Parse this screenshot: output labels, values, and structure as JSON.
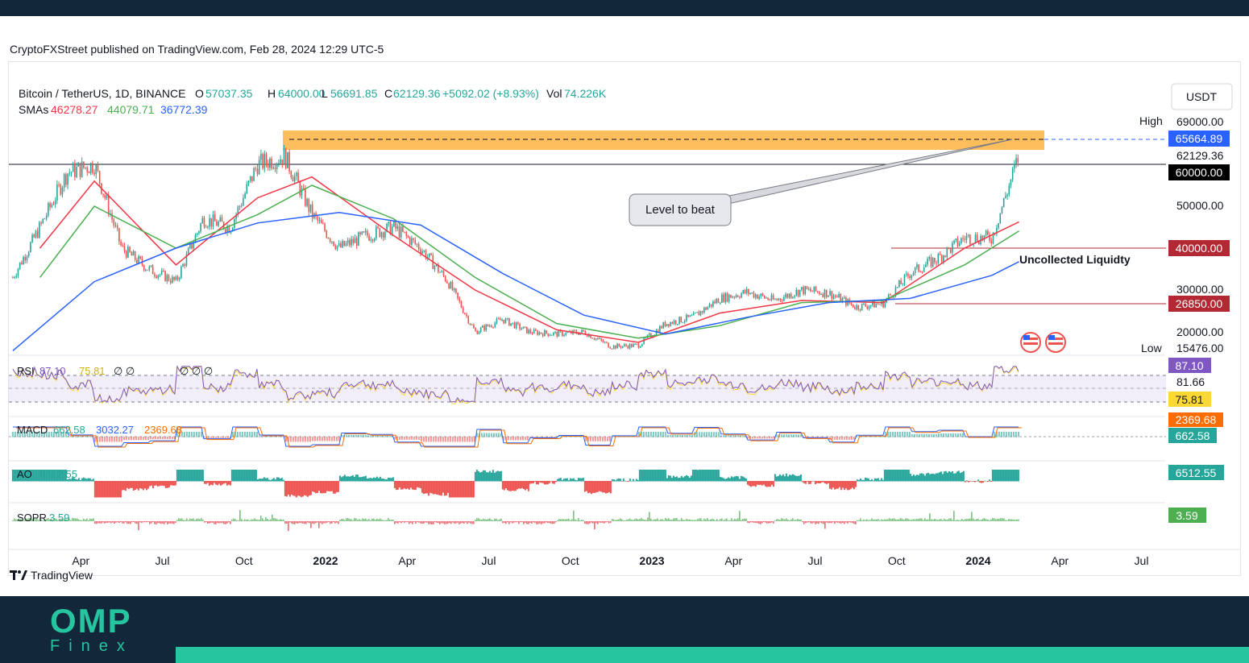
{
  "header": {
    "published": "CryptoFXStreet published on TradingView.com, Feb 28, 2024 12:29 UTC-5",
    "currency_button": "USDT"
  },
  "legend": {
    "symbol": "Bitcoin / TetherUS, 1D, BINANCE",
    "o_label": "O",
    "o": "57037.35",
    "h_label": "H",
    "h": "64000.00",
    "l_label": "L",
    "l": "56691.85",
    "c_label": "C",
    "c": "62129.36",
    "change": "+5092.02 (+8.93%)",
    "vol_label": "Vol",
    "vol": "74.226K",
    "sma_label": "SMAs",
    "sma_values": [
      "46278.27",
      "44079.71",
      "36772.39"
    ]
  },
  "colors": {
    "up": "#26a69a",
    "down": "#ef5350",
    "sma_fast": "#f23645",
    "sma_mid": "#4caf50",
    "sma_slow": "#2962ff",
    "zone": "#ffb74d",
    "rsi": "#7e57c2",
    "rsi_ma": "#fdd835",
    "macd": "#2962ff",
    "signal": "#ff6d00",
    "brand": "#27c4a0",
    "dark": "#12283a"
  },
  "price_scale": {
    "high_label": "High",
    "high": "69000.00",
    "low_label": "Low",
    "low": "15476.00",
    "labels": [
      "65664.89",
      "62129.36",
      "60000.00",
      "50000.00",
      "40000.00",
      "30000.00",
      "26850.00",
      "20000.00"
    ]
  },
  "annotations": {
    "level_to_beat": "Level to beat",
    "uncollected": "Uncollected Liquidty"
  },
  "indicators": {
    "rsi": {
      "label": "RSI",
      "v1": "87.10",
      "v2": "75.81",
      "nulls": "∅ ∅",
      "nulls2": "∅ ∅ ∅",
      "scale": [
        "87.10",
        "81.66",
        "75.81"
      ]
    },
    "macd": {
      "label": "MACD",
      "v1": "662.58",
      "v2": "3032.27",
      "v3": "2369.68",
      "scale": [
        "2369.68",
        "662.58"
      ]
    },
    "ao": {
      "label": "AO",
      "v1": "6512.55",
      "scale": [
        "6512.55"
      ]
    },
    "sopr": {
      "label": "SOPR",
      "v1": "3.59",
      "scale": [
        "3.59"
      ]
    }
  },
  "x_axis": [
    "Apr",
    "Jul",
    "Oct",
    "2022",
    "Apr",
    "Jul",
    "Oct",
    "2023",
    "Apr",
    "Jul",
    "Oct",
    "2024",
    "Apr",
    "Jul"
  ],
  "footer": {
    "tradingview": "TradingView",
    "brand_main": "OMP",
    "brand_sub": "Finex"
  },
  "chart_data": {
    "type": "line",
    "title": "Bitcoin / TetherUS, 1D, BINANCE",
    "series": [
      {
        "name": "Bitcoin / TetherUS",
        "x": [
          "2021-01",
          "2021-02",
          "2021-03",
          "2021-04",
          "2021-05",
          "2021-06",
          "2021-07",
          "2021-08",
          "2021-09",
          "2021-10",
          "2021-11",
          "2021-12",
          "2022-01",
          "2022-02",
          "2022-03",
          "2022-04",
          "2022-05",
          "2022-06",
          "2022-07",
          "2022-08",
          "2022-09",
          "2022-10",
          "2022-11",
          "2022-12",
          "2023-01",
          "2023-02",
          "2023-03",
          "2023-04",
          "2023-05",
          "2023-06",
          "2023-07",
          "2023-08",
          "2023-09",
          "2023-10",
          "2023-11",
          "2023-12",
          "2024-01",
          "2024-02"
        ],
        "values": [
          33000,
          45000,
          58000,
          60000,
          40000,
          35000,
          32000,
          47000,
          45000,
          60000,
          62000,
          48000,
          40000,
          43000,
          45000,
          40000,
          32000,
          20000,
          23000,
          20000,
          19500,
          20000,
          16500,
          16800,
          22000,
          23500,
          28000,
          29500,
          27500,
          30000,
          29300,
          26000,
          26800,
          34000,
          37500,
          42500,
          42500,
          62129
        ]
      },
      {
        "name": "SMA 46278.27",
        "x": [
          "2021-02",
          "2021-04",
          "2021-07",
          "2021-10",
          "2021-12",
          "2022-03",
          "2022-06",
          "2022-09",
          "2022-12",
          "2023-03",
          "2023-06",
          "2023-09",
          "2023-12",
          "2024-02"
        ],
        "values": [
          40000,
          56000,
          36000,
          52000,
          57000,
          43000,
          30000,
          20500,
          17500,
          24500,
          27500,
          27000,
          40000,
          46278
        ]
      },
      {
        "name": "SMA 44079.71",
        "x": [
          "2021-02",
          "2021-04",
          "2021-07",
          "2021-10",
          "2021-12",
          "2022-03",
          "2022-06",
          "2022-09",
          "2022-12",
          "2023-03",
          "2023-06",
          "2023-09",
          "2023-12",
          "2024-02"
        ],
        "values": [
          33000,
          50000,
          40000,
          48000,
          55000,
          47000,
          33000,
          22000,
          18500,
          21500,
          27000,
          27500,
          36000,
          44080
        ]
      },
      {
        "name": "SMA 36772.39",
        "x": [
          "2021-01",
          "2021-04",
          "2021-07",
          "2021-10",
          "2022-01",
          "2022-04",
          "2022-07",
          "2022-10",
          "2023-01",
          "2023-04",
          "2023-07",
          "2023-10",
          "2024-01",
          "2024-02"
        ],
        "values": [
          15500,
          32000,
          40000,
          46000,
          48500,
          45500,
          34000,
          24000,
          19500,
          23500,
          27000,
          28000,
          33500,
          36772
        ]
      }
    ],
    "horizontal_levels": [
      60000,
      40000,
      26850
    ],
    "resistance_zone": [
      63500,
      68500
    ],
    "resistance_level": 65664.89,
    "ylim": [
      15476,
      69000
    ],
    "rsi": {
      "value": 87.1,
      "ma": 75.81,
      "band": [
        30,
        70
      ]
    },
    "macd": {
      "macd": 662.58,
      "histogram": 3032.27,
      "signal": 2369.68
    },
    "ao": 6512.55,
    "sopr": 3.59
  }
}
